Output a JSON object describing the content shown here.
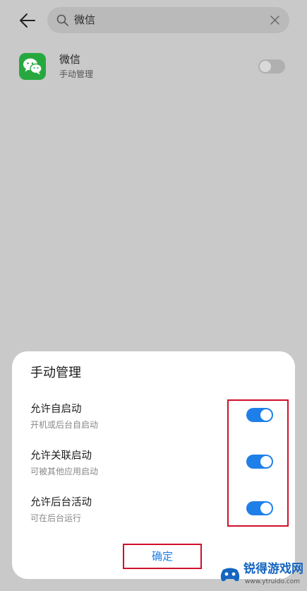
{
  "search": {
    "query": "微信"
  },
  "app": {
    "name": "微信",
    "subtitle": "手动管理",
    "enabled": false
  },
  "dialog": {
    "title": "手动管理",
    "options": [
      {
        "label": "允许自启动",
        "sub": "开机或后台自启动",
        "on": true
      },
      {
        "label": "允许关联启动",
        "sub": "可被其他应用启动",
        "on": true
      },
      {
        "label": "允许后台活动",
        "sub": "可在后台运行",
        "on": true
      }
    ],
    "confirm_label": "确定"
  },
  "watermark": {
    "title": "锐得游戏网",
    "url": "www.ytruido.com"
  },
  "colors": {
    "accent": "#1f7fe8",
    "toggle_on": "#1f7fe8",
    "toggle_off": "#b0b0b0",
    "highlight": "#d0102a",
    "wechat_green": "#27a83f",
    "overlay_bg": "#c9c9c9"
  }
}
